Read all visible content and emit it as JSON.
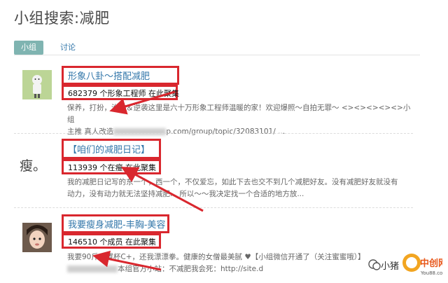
{
  "page": {
    "title": "小组搜索:减肥"
  },
  "tabs": [
    {
      "label": "小组"
    },
    {
      "label": "讨论"
    }
  ],
  "results": [
    {
      "title": "形象八卦～搭配减肥",
      "meta": "682379 个形象工程师 在此聚集",
      "desc_line1": "保养，打扮，治愈＆逆袭这里是六十万形象工程师温暖的家！欢迎爆照～自拍无罪～ <><><><><>小组",
      "desc_line2_a": "主推  真人改造",
      "desc_line2_b": "p.com/group/topic/32083101/ ..."
    },
    {
      "thumb_text": "瘦。",
      "title": "【咱们的减肥日记】",
      "meta": "113939 个在瘦 在此聚集",
      "desc_line1": "我的减肥日记写的东一个，西一个，不仅爱忘，如此下去也交不到几个减肥好友。没有减肥好友就没有",
      "desc_line2_a": "动力，没有动力就无法坚持减肥... 所以～～我决定找一个合适的地方放..."
    },
    {
      "title": "我要瘦身减肥-丰胸-美容",
      "meta": "146510 个成员 在此聚集",
      "desc_line1": "我要90斤，罩杯C+，还我漂漂拳。健康的女僧最美腻 ♥【小组微信开通了（关注蜜蜜哦）】",
      "desc_line2_a": "本组官方小站：不减肥我会死：http://site.d"
    }
  ],
  "watermark": {
    "text": "小猪",
    "logo_text": "中创网",
    "logo_sub": "You88.com"
  },
  "colors": {
    "annotation_red": "#d9272e",
    "link_blue": "#3377aa",
    "tab_active": "#7fb4b1"
  }
}
